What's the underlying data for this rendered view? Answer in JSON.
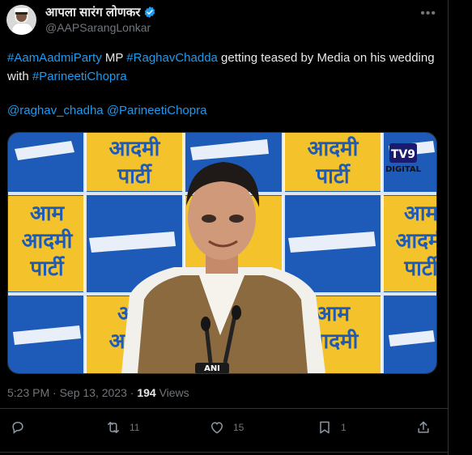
{
  "author": {
    "display_name": "आपला सारंग लोणकर",
    "handle": "@AAPSarangLonkar",
    "verified": true
  },
  "tweet": {
    "text_parts": [
      {
        "text": "#AamAadmiParty",
        "tag": true
      },
      {
        "text": " MP ",
        "tag": false
      },
      {
        "text": "#RaghavChadda",
        "tag": true
      },
      {
        "text": " getting teased by Media on his wedding with ",
        "tag": false
      },
      {
        "text": "#ParineetiChopra",
        "tag": true
      }
    ],
    "mentions": [
      "@raghav_chadha",
      "@ParineetiChopra"
    ]
  },
  "media": {
    "poster_text_hindi_top": "आदमी",
    "poster_text_hindi_bottom": "पार्टी",
    "poster_text_aam": "आम",
    "channel_logo": "TV9",
    "channel_sub": "DIGITAL",
    "mic_label": "ANI"
  },
  "meta": {
    "time": "5:23 PM · Sep 13, 2023 · ",
    "views_count": "194",
    "views_label": " Views"
  },
  "actions": {
    "reply": "",
    "retweet": "11",
    "like": "15",
    "bookmark": "1",
    "share": ""
  },
  "colors": {
    "accent": "#1d9bf0",
    "text": "#e7e9ea",
    "muted": "#71767b",
    "aap_yellow": "#f4c32b",
    "aap_blue": "#1e5bb8"
  }
}
